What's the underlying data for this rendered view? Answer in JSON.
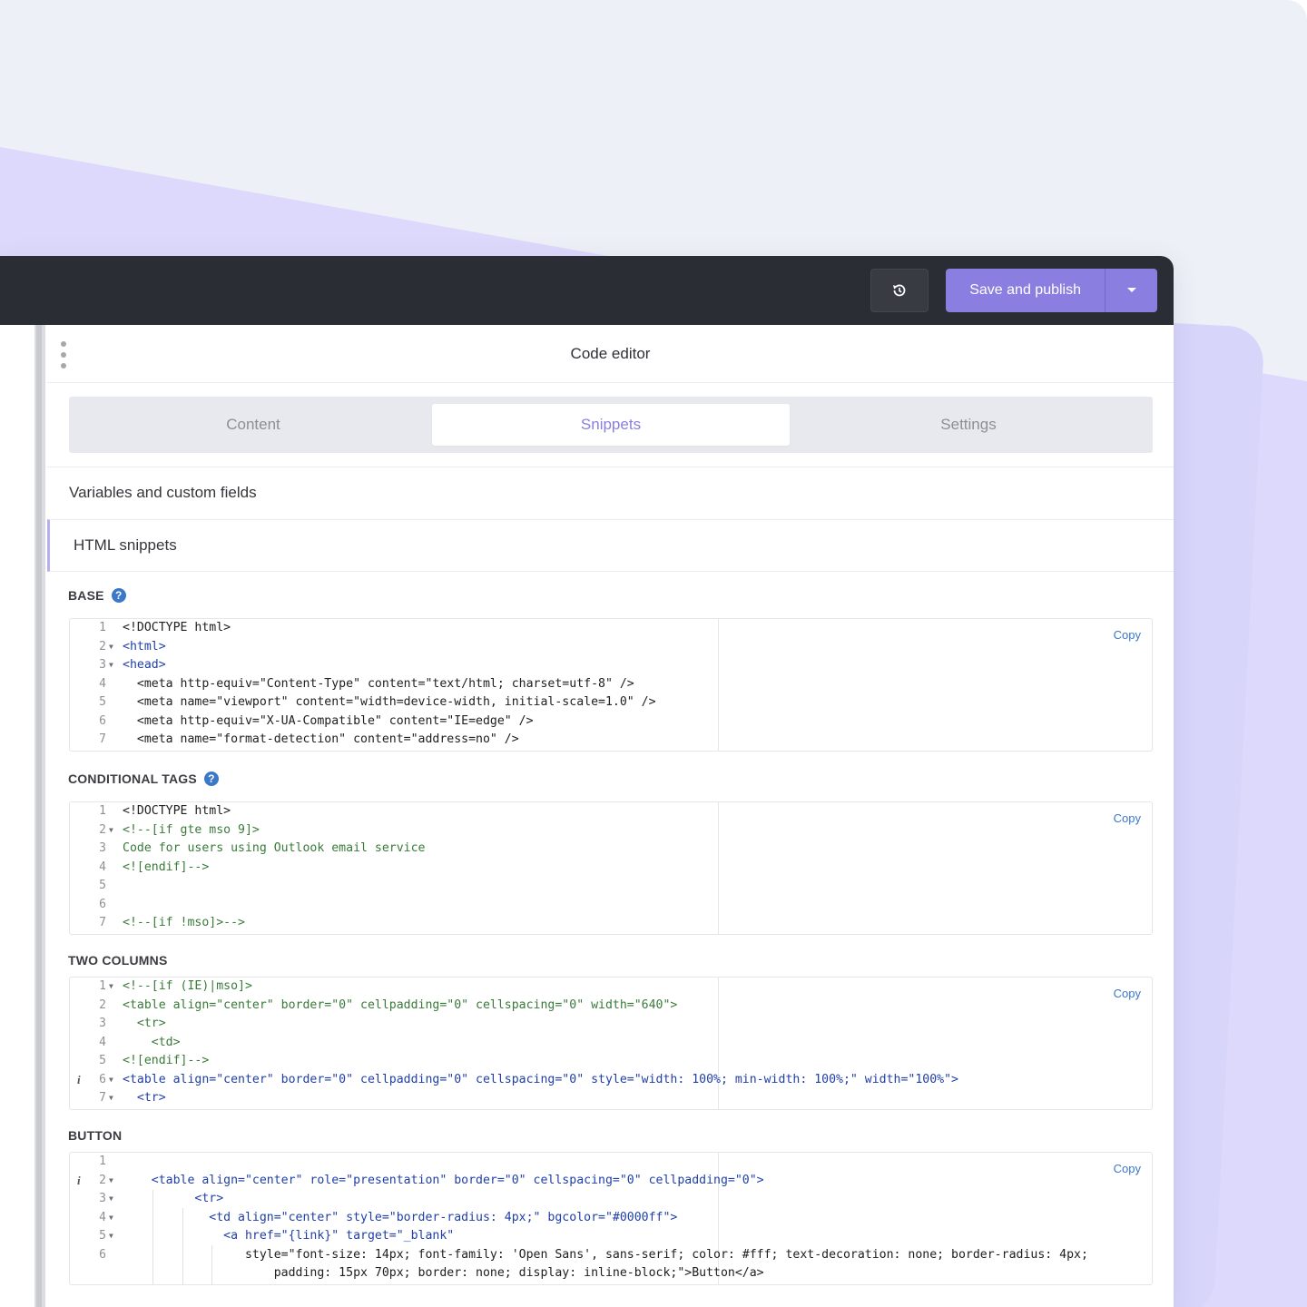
{
  "toolbar": {
    "history_icon": "history-icon",
    "publish_label": "Save and publish",
    "caret_icon": "caret-down-icon"
  },
  "panel": {
    "title": "Code editor",
    "tabs": [
      {
        "label": "Content",
        "active": false
      },
      {
        "label": "Snippets",
        "active": true
      },
      {
        "label": "Settings",
        "active": false
      }
    ],
    "sections": {
      "vars": "Variables and custom fields",
      "html": "HTML snippets"
    }
  },
  "snippets": [
    {
      "label": "BASE",
      "copy": "Copy",
      "lines": [
        "<!DOCTYPE html>",
        "<html>",
        "<head>",
        "  <meta http-equiv=\"Content-Type\" content=\"text/html; charset=utf-8\" />",
        "  <meta name=\"viewport\" content=\"width=device-width, initial-scale=1.0\" />",
        "  <meta http-equiv=\"X-UA-Compatible\" content=\"IE=edge\" />",
        "  <meta name=\"format-detection\" content=\"address=no\" />"
      ]
    },
    {
      "label": "CONDITIONAL TAGS",
      "copy": "Copy",
      "lines": [
        "<!DOCTYPE html>",
        "<!--[if gte mso 9]>",
        "Code for users using Outlook email service",
        "<![endif]-->",
        "",
        "",
        "<!--[if !mso]>-->"
      ]
    },
    {
      "label": "TWO COLUMNS",
      "copy": "Copy",
      "lines": [
        "<!--[if (IE)|mso]>",
        "<table align=\"center\" border=\"0\" cellpadding=\"0\" cellspacing=\"0\" width=\"640\">",
        "  <tr>",
        "    <td>",
        "<![endif]-->",
        "<table align=\"center\" border=\"0\" cellpadding=\"0\" cellspacing=\"0\" style=\"width: 100%; min-width: 100%;\" width=\"100%\">",
        "  <tr>"
      ]
    },
    {
      "label": "BUTTON",
      "copy": "Copy",
      "lines": [
        "",
        "    <table align=\"center\" role=\"presentation\" border=\"0\" cellspacing=\"0\" cellpadding=\"0\">",
        "          <tr>",
        "            <td align=\"center\" style=\"border-radius: 4px;\" bgcolor=\"#0000ff\">",
        "              <a href=\"{link}\" target=\"_blank\"",
        "                 style=\"font-size: 14px; font-family: 'Open Sans', sans-serif; color: #fff; text-decoration: none; border-radius: 4px;",
        "                     padding: 15px 70px; border: none; display: inline-block;\">Button</a>"
      ]
    }
  ],
  "colors": {
    "accent": "#8a7fe0",
    "topbar": "#2a2d33",
    "link": "#3b78c8"
  }
}
